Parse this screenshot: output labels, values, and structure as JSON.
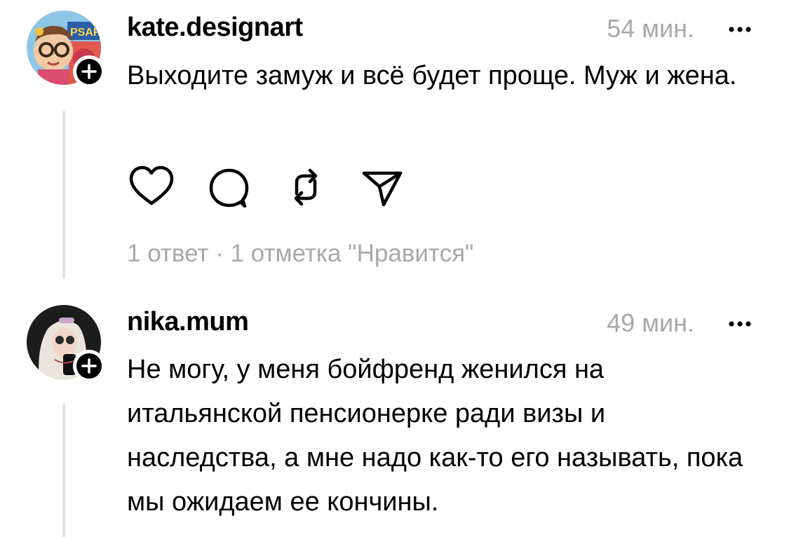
{
  "comments": [
    {
      "username": "kate.designart",
      "time": "54 мин.",
      "avatar_label": "PSAR",
      "text": "Выходите замуж и всё будет проще. Муж и жена.",
      "replies_text": "1 ответ",
      "separator": "·",
      "likes_text": "1 отметка \"Нравится\"",
      "icons": [
        "heart-icon",
        "comment-icon",
        "repost-icon",
        "share-icon"
      ]
    },
    {
      "username": "nika.mum",
      "time": "49 мин.",
      "text": "Не могу, у меня бойфренд женился на итальянской пенсионерке ради визы и наследства, а мне надо как-то его называть, пока мы ожидаем ее кончины."
    }
  ],
  "colors": {
    "text": "#000000",
    "muted": "#a8a8a8",
    "thread_line": "#e3e3e3",
    "badge": "#000000"
  }
}
